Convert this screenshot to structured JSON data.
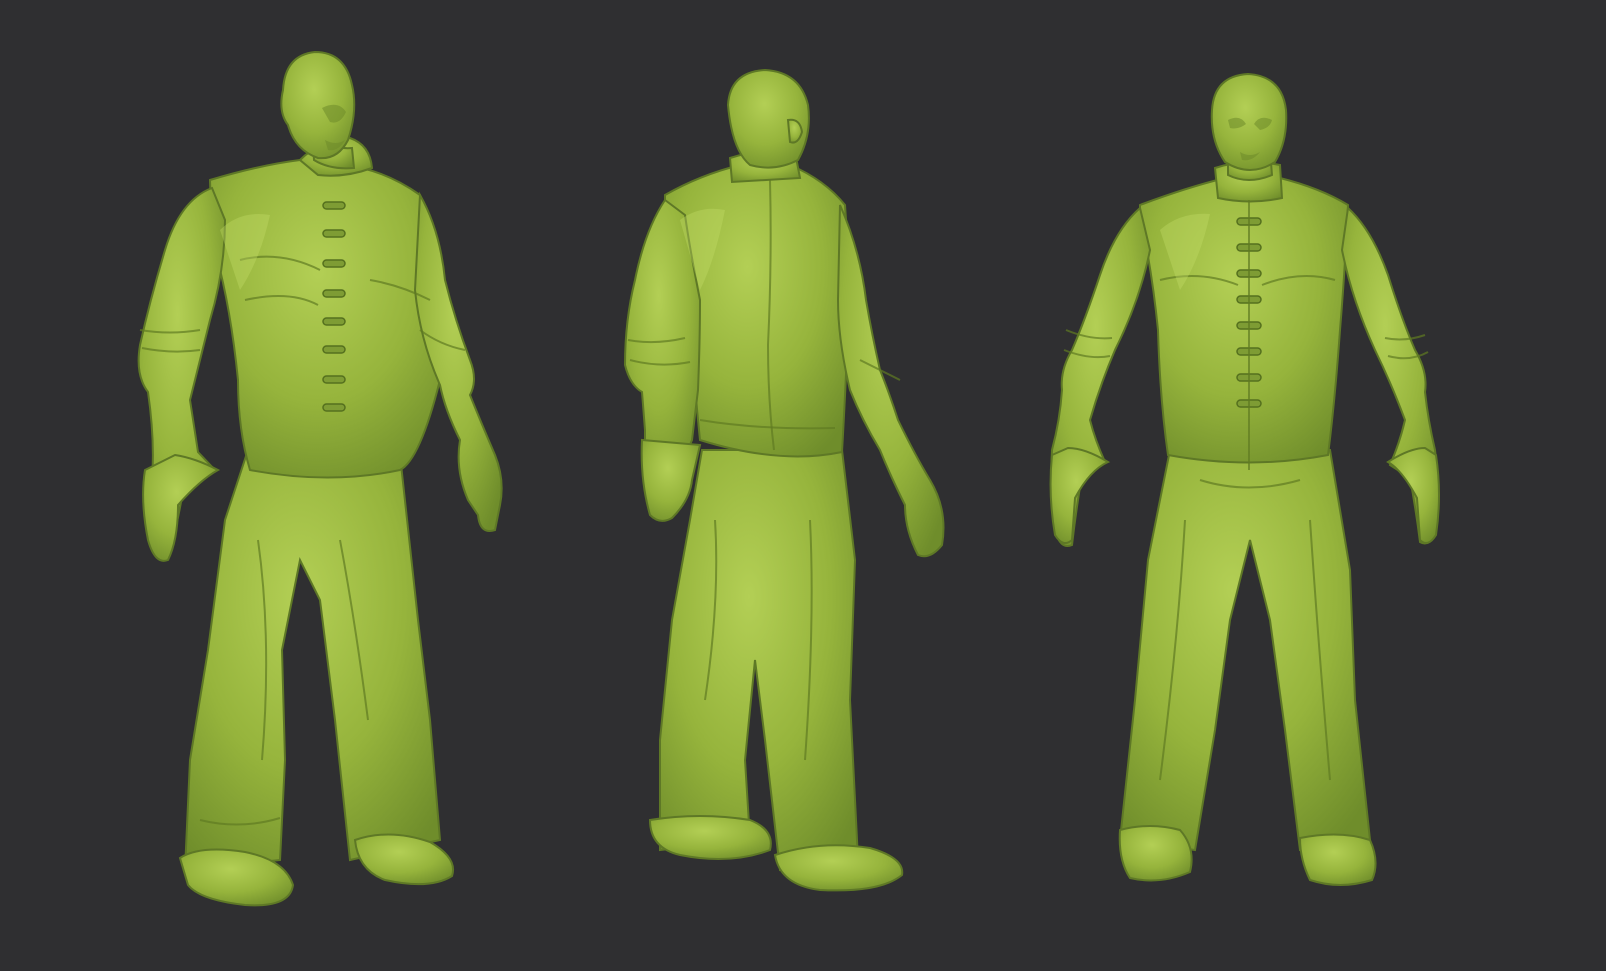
{
  "scene": {
    "background_color": "#2f2f31",
    "clay_color": "#9ab83f",
    "clay_highlight": "#b8d45a",
    "clay_shadow": "#6a8729"
  },
  "figures": [
    {
      "view": "three-quarter-front"
    },
    {
      "view": "three-quarter-back"
    },
    {
      "view": "front"
    }
  ]
}
